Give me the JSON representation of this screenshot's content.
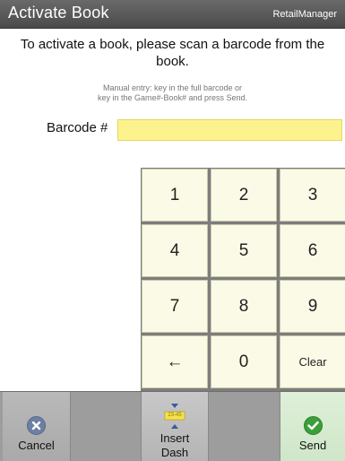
{
  "header": {
    "title": "Activate Book",
    "brand": "RetailManager"
  },
  "instructions": {
    "main": "To activate a book, please scan a barcode from the book.",
    "sub_line1": "Manual entry: key in the full barcode or",
    "sub_line2": "key in the Game#-Book# and press Send."
  },
  "barcode": {
    "label": "Barcode #",
    "value": ""
  },
  "keypad": {
    "keys": [
      "1",
      "2",
      "3",
      "4",
      "5",
      "6",
      "7",
      "8",
      "9",
      "←",
      "0",
      "Clear"
    ]
  },
  "toolbar": {
    "cancel_label": "Cancel",
    "insert_dash_line1": "Insert",
    "insert_dash_line2": "Dash",
    "dash_icon_text": "23-45",
    "send_label": "Send"
  },
  "icons": {
    "cancel": "x-circle-icon",
    "send": "check-circle-icon",
    "insert_dash": "insert-dash-icon"
  },
  "colors": {
    "input_bg": "#fdf38c",
    "key_bg": "#fafae6",
    "send_bg": "#d8ecd2",
    "header_bg": "#5a5a5a"
  }
}
